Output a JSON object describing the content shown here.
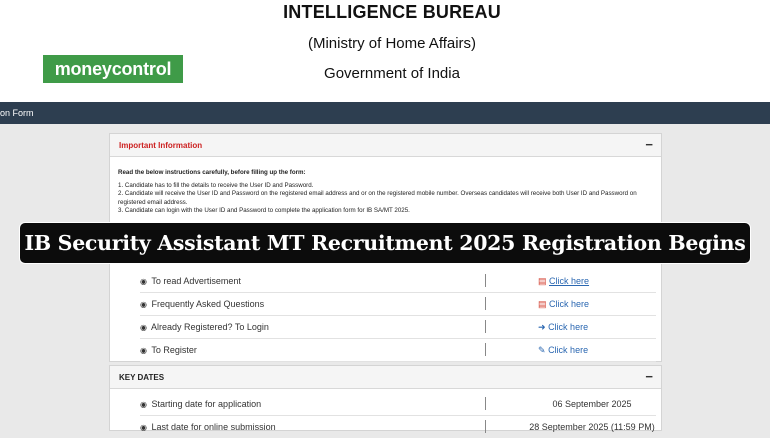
{
  "header": {
    "title": "INTELLIGENCE BUREAU",
    "ministry": "(Ministry of Home Affairs)",
    "government": "Government of India",
    "logo_text": "moneycontrol"
  },
  "navbar": {
    "label": "on Form"
  },
  "important_info": {
    "heading": "Important Information",
    "intro": "Read the below instructions carefully, before filling up the form:",
    "items": [
      "1. Candidate has to fill the details to receive the User ID and Password.",
      "2. Candidate will receive the User ID and Password on the registered email address and or on the registered mobile number. Overseas candidates will receive both User ID and Password on registered email address.",
      "3. Candidate can login with the User ID and Password to complete the application form for IB SA/MT 2025."
    ]
  },
  "links": [
    {
      "label": "To read Advertisement",
      "link": "Click here",
      "icon": "pdf-icon"
    },
    {
      "label": "Frequently Asked Questions",
      "link": "Click here",
      "icon": "pdf-icon"
    },
    {
      "label": "Already Registered? To Login",
      "link": "Click here",
      "icon": "sign-in-icon"
    },
    {
      "label": "To Register",
      "link": "Click here",
      "icon": "edit-icon"
    }
  ],
  "key_dates": {
    "heading": "KEY DATES",
    "rows": [
      {
        "label": "Starting date for application",
        "value": "06 September 2025"
      },
      {
        "label": "Last date for online submission",
        "value": "28 September 2025 (11:59 PM)"
      }
    ]
  },
  "banner": {
    "text": "IB Security Assistant MT Recruitment 2025 Registration Begins"
  },
  "colors": {
    "navbar": "#2d3e50",
    "logo": "#3f9b48",
    "link": "#2a67b1",
    "important": "#cc1f1f"
  }
}
